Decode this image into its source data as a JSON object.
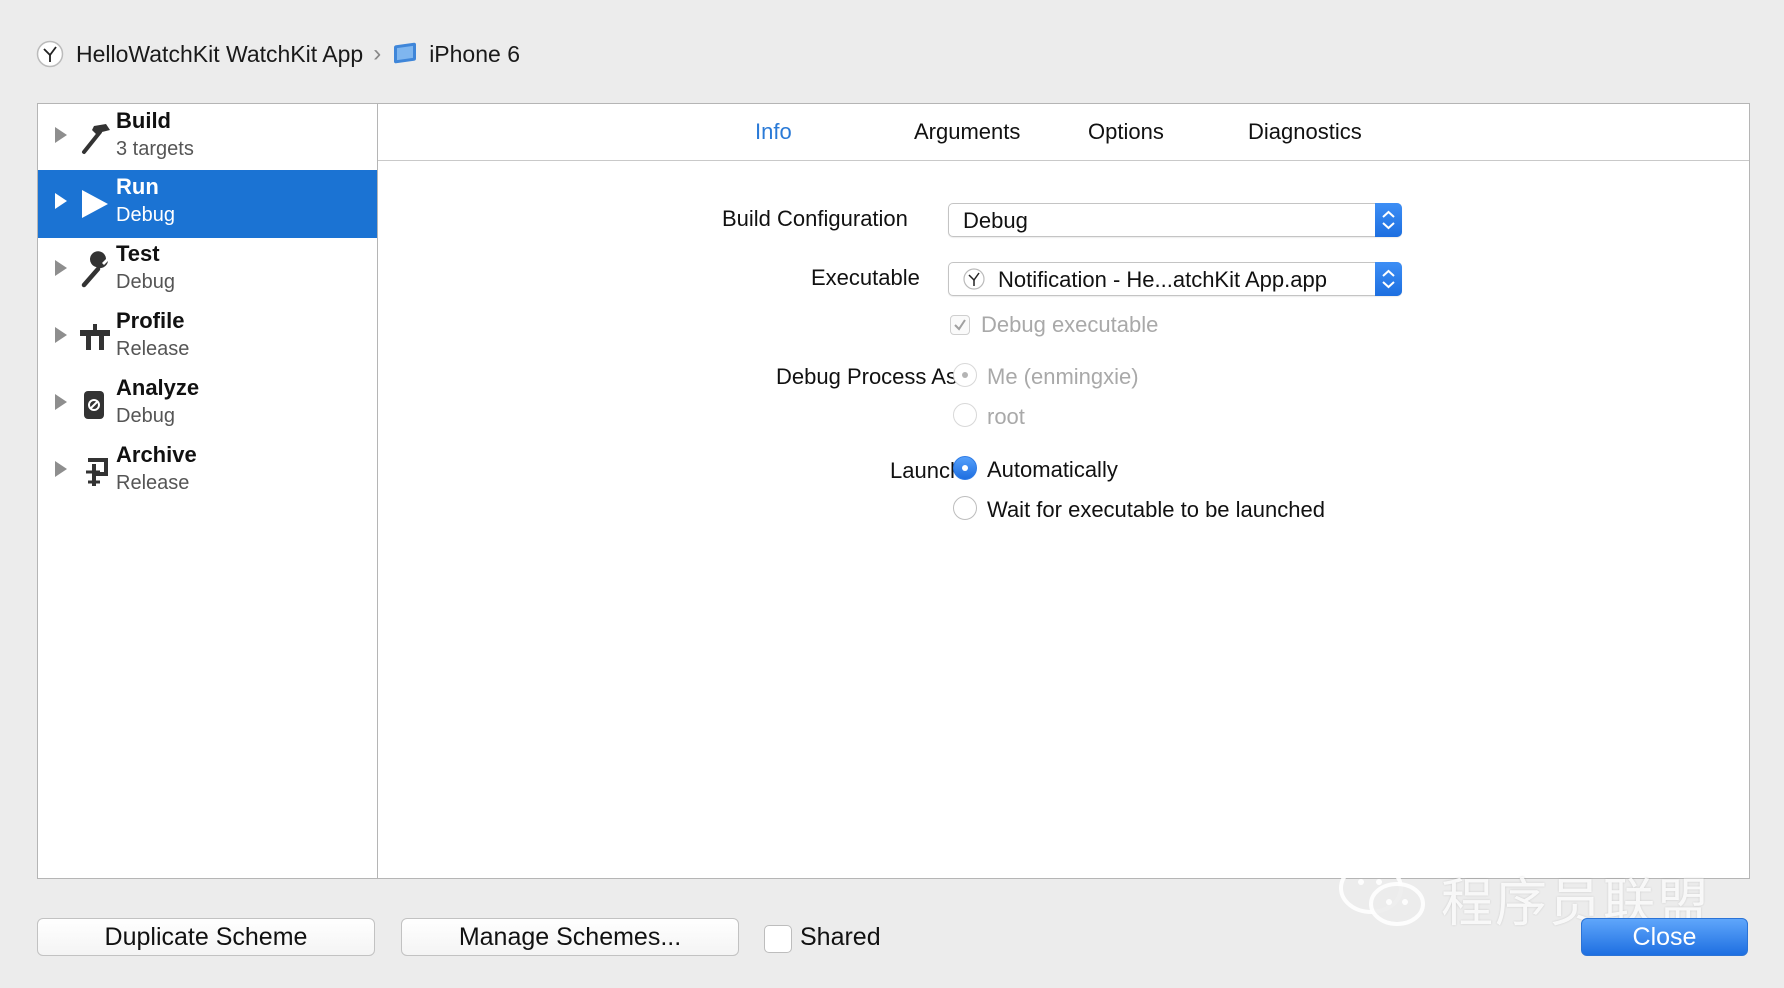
{
  "breadcrumb": {
    "scheme": "HelloWatchKit WatchKit App",
    "device": "iPhone 6",
    "scheme_icon": "watchkit-icon",
    "device_icon": "iphone-simulator-icon"
  },
  "sidebar": {
    "items": [
      {
        "title": "Build",
        "subtitle": "3 targets",
        "icon": "hammer-icon",
        "selected": false
      },
      {
        "title": "Run",
        "subtitle": "Debug",
        "icon": "play-icon",
        "selected": true
      },
      {
        "title": "Test",
        "subtitle": "Debug",
        "icon": "wrench-icon",
        "selected": false
      },
      {
        "title": "Profile",
        "subtitle": "Release",
        "icon": "instruments-icon",
        "selected": false
      },
      {
        "title": "Analyze",
        "subtitle": "Debug",
        "icon": "analyze-icon",
        "selected": false
      },
      {
        "title": "Archive",
        "subtitle": "Release",
        "icon": "archive-icon",
        "selected": false
      }
    ]
  },
  "tabs": [
    {
      "label": "Info",
      "active": true
    },
    {
      "label": "Arguments",
      "active": false
    },
    {
      "label": "Options",
      "active": false
    },
    {
      "label": "Diagnostics",
      "active": false
    }
  ],
  "info": {
    "build_configuration_label": "Build Configuration",
    "build_configuration_value": "Debug",
    "executable_label": "Executable",
    "executable_value": "Notification - He...atchKit App.app",
    "debug_executable_label": "Debug executable",
    "debug_executable_checked": true,
    "debug_process_as_label": "Debug Process As",
    "debug_process_options": [
      "Me (enmingxie)",
      "root"
    ],
    "launch_label": "Launch",
    "launch_options": [
      "Automatically",
      "Wait for executable to be launched"
    ],
    "launch_selected": "Automatically"
  },
  "footer": {
    "duplicate_label": "Duplicate Scheme",
    "manage_label": "Manage Schemes...",
    "shared_label": "Shared",
    "shared_checked": false,
    "close_label": "Close"
  },
  "watermark": {
    "text": "程序员联盟",
    "icon": "wechat-icon"
  },
  "colors": {
    "accent": "#1b73d3",
    "active_tab": "#2a7ad7",
    "background": "#ececec"
  }
}
